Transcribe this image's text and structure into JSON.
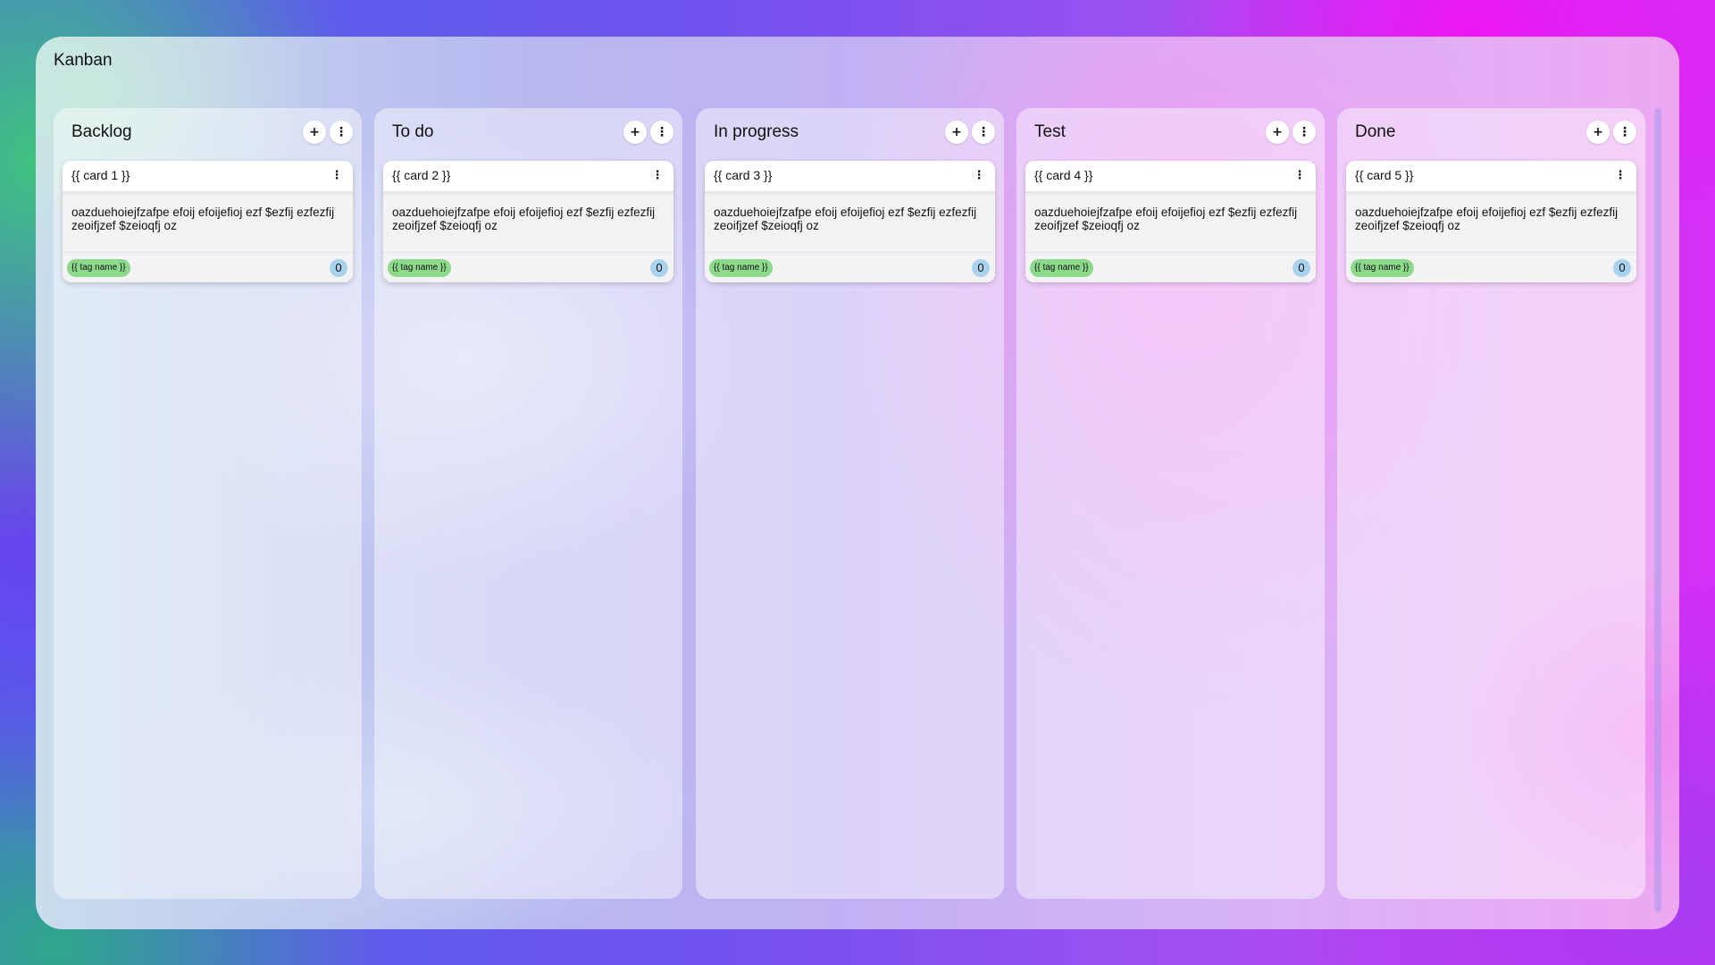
{
  "app": {
    "title": "Kanban"
  },
  "columns": [
    {
      "title": "Backlog",
      "card": {
        "title": "{{ card 1 }}",
        "description": "oazduehoiejfzafpe efoij efoijefioj ezf $ezfij ezfezfij zeoifjzef $zeioqfj oz",
        "tag": "{{ tag name }}",
        "count": "0"
      }
    },
    {
      "title": "To do",
      "card": {
        "title": "{{ card 2 }}",
        "description": "oazduehoiejfzafpe efoij efoijefioj ezf $ezfij ezfezfij zeoifjzef $zeioqfj oz",
        "tag": "{{ tag name }}",
        "count": "0"
      }
    },
    {
      "title": "In progress",
      "card": {
        "title": "{{ card 3 }}",
        "description": "oazduehoiejfzafpe efoij efoijefioj ezf $ezfij ezfezfij zeoifjzef $zeioqfj oz",
        "tag": "{{ tag name }}",
        "count": "0"
      }
    },
    {
      "title": "Test",
      "card": {
        "title": "{{ card 4 }}",
        "description": "oazduehoiejfzafpe efoij efoijefioj ezf $ezfij ezfezfij zeoifjzef $zeioqfj oz",
        "tag": "{{ tag name }}",
        "count": "0"
      }
    },
    {
      "title": "Done",
      "card": {
        "title": "{{ card 5 }}",
        "description": "oazduehoiejfzafpe efoij efoijefioj ezf $ezfij ezfezfij zeoifjzef $zeioqfj oz",
        "tag": "{{ tag name }}",
        "count": "0"
      }
    }
  ],
  "icons": {
    "add": "plus-icon",
    "column_menu": "vertical-dots-icon",
    "card_menu": "vertical-dots-icon"
  },
  "colors": {
    "tag": "#8cd98c",
    "count_badge": "#a9d3ec"
  }
}
